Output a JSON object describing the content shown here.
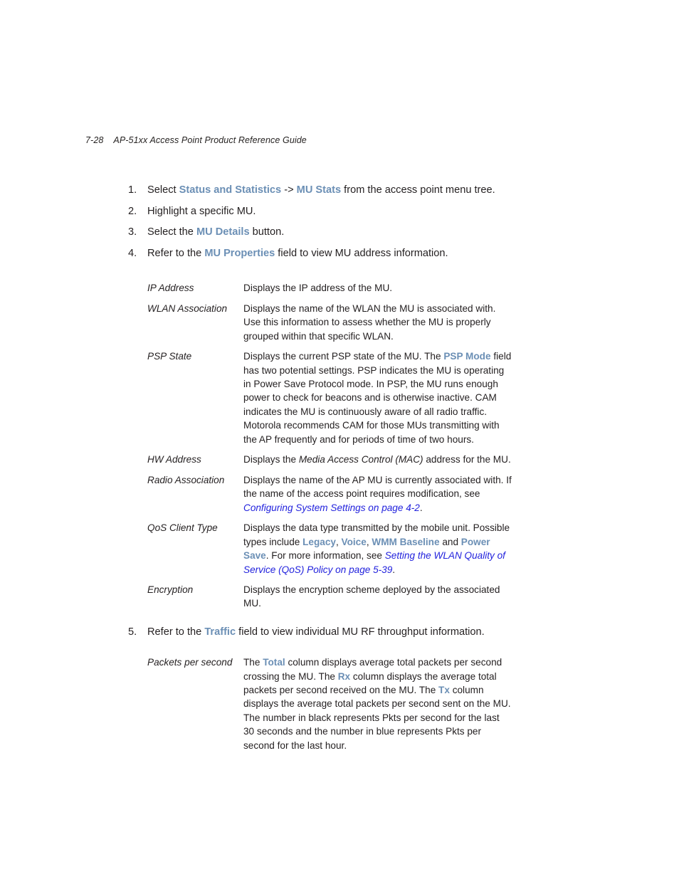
{
  "header": {
    "folio": "7-28",
    "title": "AP-51xx Access Point Product Reference Guide"
  },
  "colors": {
    "emphasis_blue": "#6b8fb5",
    "crossref_blue": "#2222dd",
    "body_text": "#231f20",
    "page_background": "#ffffff"
  },
  "steps": [
    {
      "number": "1.",
      "parts": [
        {
          "text": "Select ",
          "style": "plain"
        },
        {
          "text": "Status and Statistics",
          "style": "emphasis"
        },
        {
          "text": " -> ",
          "style": "plain"
        },
        {
          "text": "MU Stats",
          "style": "emphasis"
        },
        {
          "text": " from the access point menu tree.",
          "style": "plain"
        }
      ]
    },
    {
      "number": "2.",
      "parts": [
        {
          "text": "Highlight a specific MU.",
          "style": "plain"
        }
      ]
    },
    {
      "number": "3.",
      "parts": [
        {
          "text": "Select the ",
          "style": "plain"
        },
        {
          "text": "MU Details",
          "style": "emphasis"
        },
        {
          "text": " button.",
          "style": "plain"
        }
      ]
    },
    {
      "number": "4.",
      "parts": [
        {
          "text": "Refer to the ",
          "style": "plain"
        },
        {
          "text": "MU Properties",
          "style": "emphasis"
        },
        {
          "text": " field to view MU address information.",
          "style": "plain"
        }
      ]
    }
  ],
  "properties_table": [
    {
      "term": "IP Address",
      "parts": [
        {
          "text": "Displays the IP address of the MU.",
          "style": "plain"
        }
      ]
    },
    {
      "term": "WLAN Association",
      "parts": [
        {
          "text": "Displays the name of the WLAN the MU is associated with. Use this information to assess whether the MU is properly grouped within that specific WLAN.",
          "style": "plain"
        }
      ]
    },
    {
      "term": "PSP State",
      "parts": [
        {
          "text": "Displays the current PSP state of the MU. The ",
          "style": "plain"
        },
        {
          "text": "PSP Mode",
          "style": "emphasis"
        },
        {
          "text": " field has two potential settings. PSP indicates the MU is operating in Power Save Protocol mode. In PSP, the MU runs enough power to check for beacons and is otherwise inactive. CAM indicates the MU is continuously aware of all radio traffic. Motorola recommends CAM for those MUs transmitting with the AP frequently and for periods of time of two hours.",
          "style": "plain"
        }
      ]
    },
    {
      "term": "HW Address",
      "parts": [
        {
          "text": "Displays the ",
          "style": "plain"
        },
        {
          "text": "Media Access Control (MAC)",
          "style": "italic"
        },
        {
          "text": " address for the MU.",
          "style": "plain"
        }
      ]
    },
    {
      "term": "Radio Association",
      "parts": [
        {
          "text": "Displays the name of the AP MU is currently associated with. If the name of the access point requires modification, see ",
          "style": "plain"
        },
        {
          "text": "Configuring System Settings on page 4-2",
          "style": "crossref"
        },
        {
          "text": ".",
          "style": "plain"
        }
      ]
    },
    {
      "term": "QoS Client Type",
      "parts": [
        {
          "text": "Displays the data type transmitted by the mobile unit. Possible types include ",
          "style": "plain"
        },
        {
          "text": "Legacy",
          "style": "emphasis"
        },
        {
          "text": ", ",
          "style": "plain"
        },
        {
          "text": "Voice",
          "style": "emphasis"
        },
        {
          "text": ", ",
          "style": "plain"
        },
        {
          "text": "WMM Baseline",
          "style": "emphasis"
        },
        {
          "text": " and ",
          "style": "plain"
        },
        {
          "text": "Power Save",
          "style": "emphasis"
        },
        {
          "text": ". For more information, see ",
          "style": "plain"
        },
        {
          "text": "Setting the WLAN Quality of Service (QoS) Policy on page 5-39",
          "style": "crossref"
        },
        {
          "text": ".",
          "style": "plain"
        }
      ]
    },
    {
      "term": "Encryption",
      "parts": [
        {
          "text": "Displays the encryption scheme deployed by the associated MU.",
          "style": "plain"
        }
      ]
    }
  ],
  "step5": {
    "number": "5.",
    "parts": [
      {
        "text": "Refer to the ",
        "style": "plain"
      },
      {
        "text": "Traffic",
        "style": "emphasis"
      },
      {
        "text": " field to view individual MU RF throughput information.",
        "style": "plain"
      }
    ]
  },
  "traffic_table": [
    {
      "term": "Packets per second",
      "parts": [
        {
          "text": "The ",
          "style": "plain"
        },
        {
          "text": "Total",
          "style": "emphasis"
        },
        {
          "text": " column displays average total packets per second crossing the MU. The ",
          "style": "plain"
        },
        {
          "text": "Rx",
          "style": "emphasis"
        },
        {
          "text": " column displays the average total packets per second received on the MU. The ",
          "style": "plain"
        },
        {
          "text": "Tx",
          "style": "emphasis"
        },
        {
          "text": " column displays the average total packets per second sent on the MU. The number in black represents Pkts per second for the last 30 seconds and the number in blue represents Pkts per second for the last hour.",
          "style": "plain"
        }
      ]
    }
  ]
}
